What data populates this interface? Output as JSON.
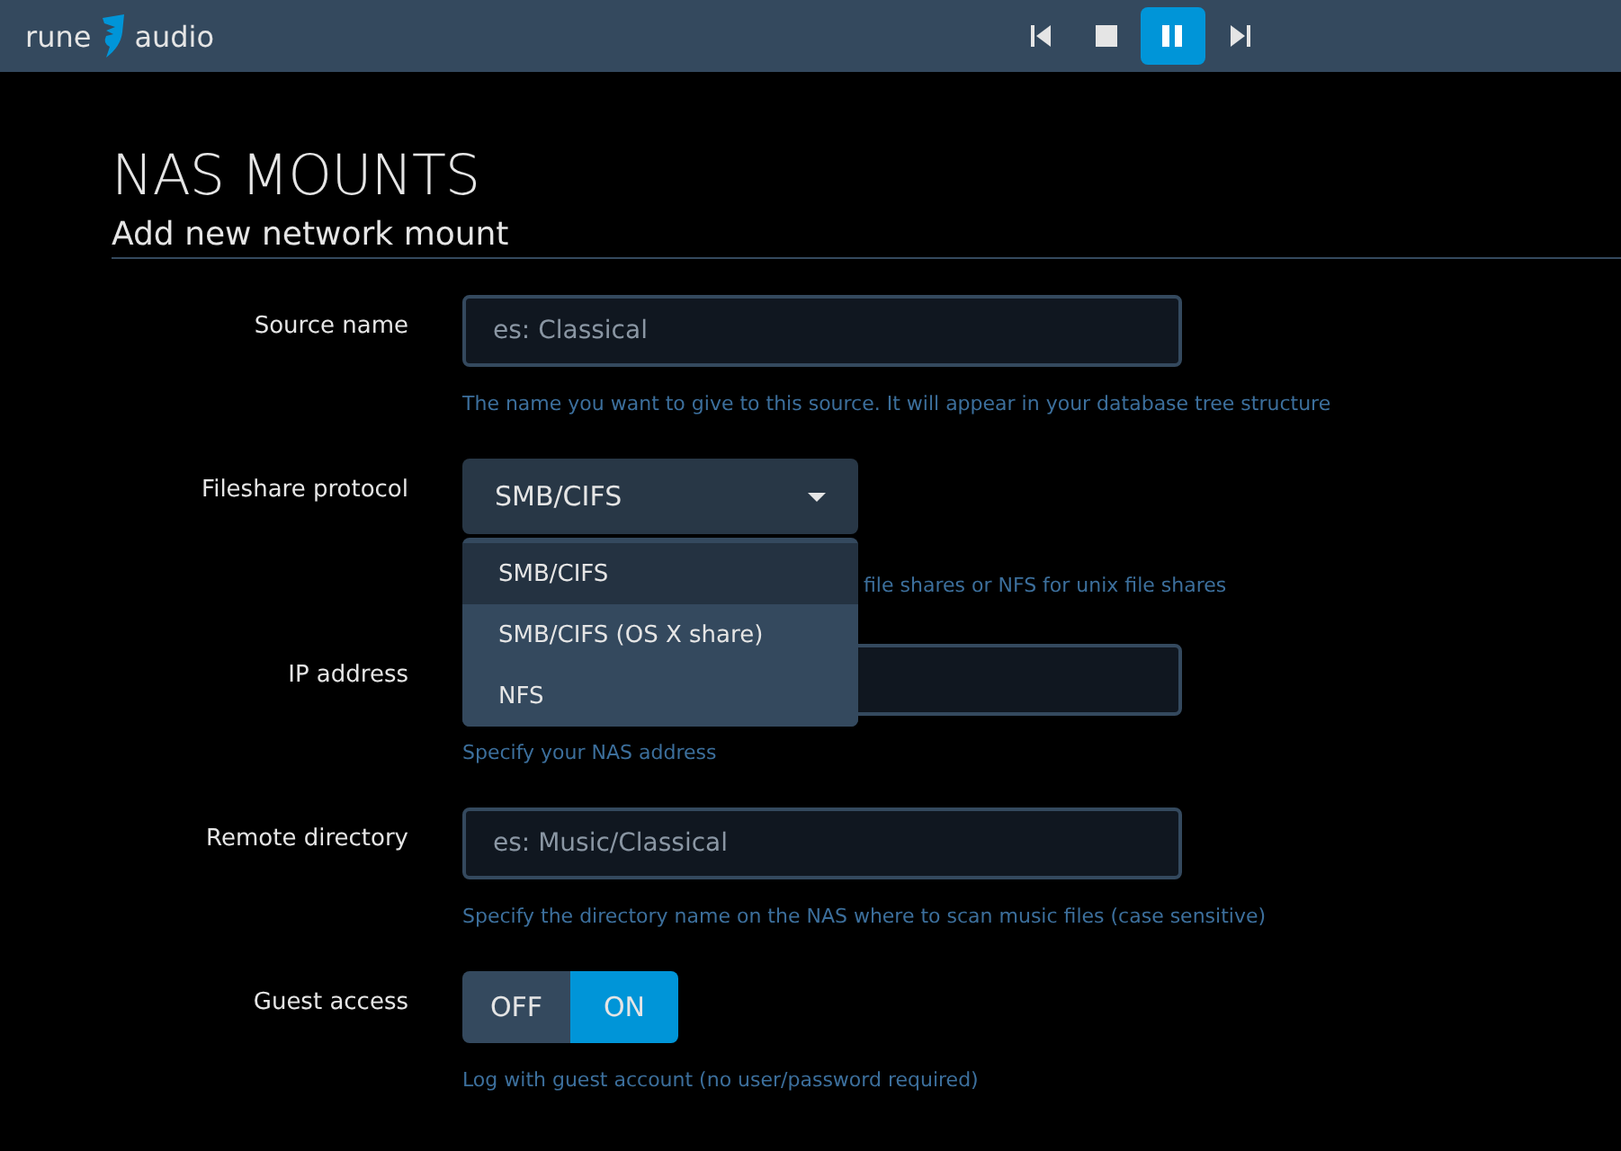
{
  "brand": {
    "left": "rune",
    "right": "audio"
  },
  "player": [
    {
      "kind": "previous",
      "selected": false
    },
    {
      "kind": "stop",
      "selected": false
    },
    {
      "kind": "pause",
      "selected": true
    },
    {
      "kind": "next",
      "selected": false
    }
  ],
  "title": "NAS MOUNTS",
  "subtitle": "Add new network mount",
  "fields": [
    {
      "kind": "text",
      "label": "Source name",
      "placeholder": "es: Classical",
      "help": "The name you want to give to this source. It will appear in your database tree structure"
    },
    {
      "kind": "select",
      "label": "Fileshare protocol",
      "value": "SMB/CIFS",
      "help": "file shares or NFS for unix file shares",
      "expanded": true,
      "options": [
        {
          "label": "SMB/CIFS",
          "selected": true
        },
        {
          "label": "SMB/CIFS (OS X share)",
          "selected": false
        },
        {
          "label": "NFS",
          "selected": false
        }
      ]
    },
    {
      "kind": "text",
      "label": "IP address",
      "help": "Specify your NAS address"
    },
    {
      "kind": "text",
      "label": "Remote directory",
      "placeholder": "es: Music/Classical",
      "help": "Specify the directory name on the NAS where to scan music files (case sensitive)"
    },
    {
      "kind": "toggle",
      "label": "Guest access",
      "options": [
        {
          "label": "OFF",
          "selected": false
        },
        {
          "label": "ON",
          "selected": true
        }
      ],
      "help": "Log with guest account (no user/password required)"
    }
  ]
}
